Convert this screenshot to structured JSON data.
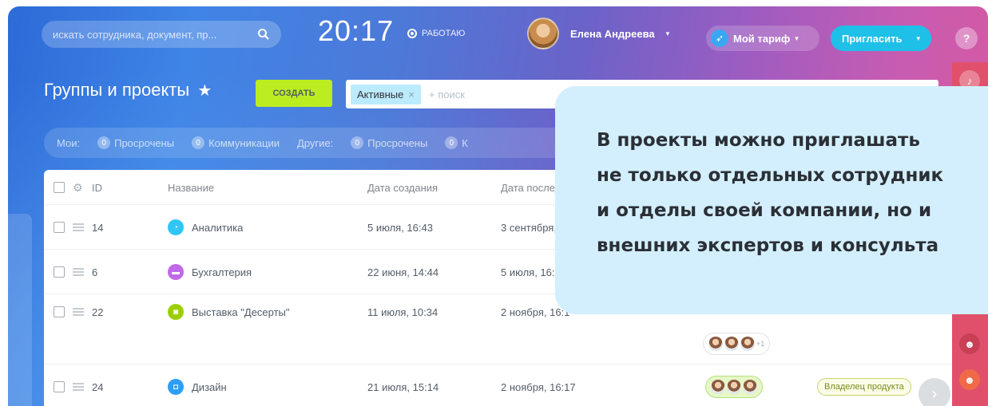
{
  "topbar": {
    "search_placeholder": "искать сотрудника, документ, пр...",
    "time": "20:17",
    "status": "РАБОТАЮ",
    "user_name": "Елена Андреева",
    "tariff_label": "Мой тариф",
    "invite_label": "Пригласить",
    "help": "?"
  },
  "page": {
    "title": "Группы и проекты",
    "create_label": "СОЗДАТЬ",
    "filter_chip": "Активные",
    "search_placeholder": "+ поиск"
  },
  "counters": {
    "mine_label": "Мои:",
    "others_label": "Другие:",
    "items": [
      {
        "count": "0",
        "label": "Просрочены"
      },
      {
        "count": "0",
        "label": "Коммуникации"
      },
      {
        "count": "0",
        "label": "Просрочены"
      },
      {
        "count": "0",
        "label": "К"
      }
    ]
  },
  "table": {
    "headers": {
      "id": "ID",
      "name": "Название",
      "created": "Дата создания",
      "last": "Дата послед"
    },
    "rows": [
      {
        "id": "14",
        "name": "Аналитика",
        "created": "5 июля, 16:43",
        "last": "3 сентября,",
        "color": "#2fc6f6"
      },
      {
        "id": "6",
        "name": "Бухгалтерия",
        "created": "22 июня, 14:44",
        "last": "5 июля, 16:3",
        "color": "#c068e8"
      },
      {
        "id": "22",
        "name": "Выставка \"Десерты\"",
        "created": "11 июля, 10:34",
        "last": "2 ноября, 16:1",
        "color": "#9dcf00",
        "extra_members": "+1"
      },
      {
        "id": "24",
        "name": "Дизайн",
        "created": "21 июля, 15:14",
        "last": "2 ноября, 16:17",
        "color": "#2d9ef5",
        "role": "Владелец продукта"
      }
    ]
  },
  "bubble": {
    "lines": [
      "В проекты можно приглашать",
      "не только отдельных сотрудник",
      "и отделы своей компании, но и",
      "внешних экспертов и консульта"
    ]
  },
  "colors": {
    "accent_green": "#bbed21",
    "invite_blue": "#1fc0e8",
    "rail_red": "#e0506a",
    "bubble_bg": "#d3effd"
  }
}
